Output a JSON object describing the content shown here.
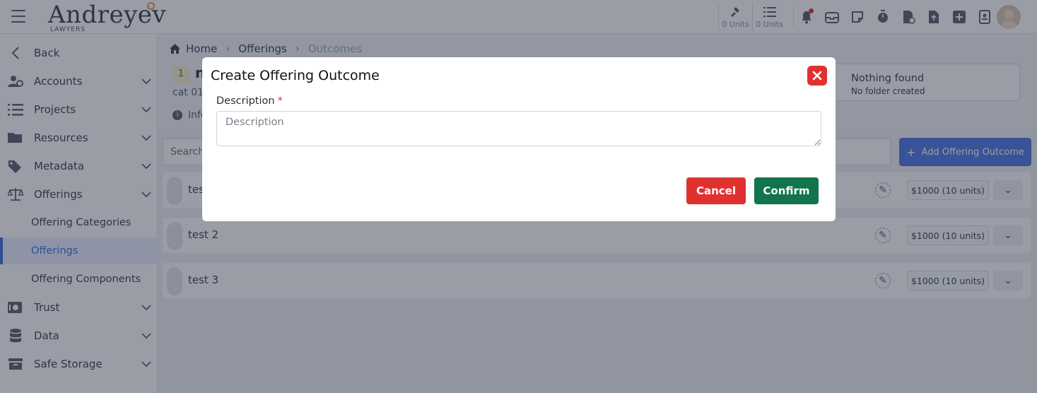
{
  "header": {
    "logo_main": "Andreyev",
    "logo_sub": "LAWYERS",
    "units": [
      {
        "label": "0 Units",
        "icon": "gavel-icon"
      },
      {
        "label": "0 Units",
        "icon": "list-icon"
      }
    ],
    "icons": [
      "bell-icon",
      "inbox-icon",
      "note-icon",
      "timer-icon",
      "billing-icon",
      "upload-icon",
      "add-icon",
      "contact-card-icon"
    ]
  },
  "sidebar": {
    "back": "Back",
    "items": [
      {
        "label": "Accounts",
        "icon": "accounts-icon"
      },
      {
        "label": "Projects",
        "icon": "projects-icon"
      },
      {
        "label": "Resources",
        "icon": "folder-icon"
      },
      {
        "label": "Metadata",
        "icon": "tags-icon"
      },
      {
        "label": "Offerings",
        "icon": "scale-icon"
      }
    ],
    "sub_items": [
      {
        "label": "Offering Categories"
      },
      {
        "label": "Offerings",
        "active": true
      },
      {
        "label": "Offering Components"
      }
    ],
    "more_items": [
      {
        "label": "Trust",
        "icon": "safe-icon"
      },
      {
        "label": "Data",
        "icon": "database-icon"
      },
      {
        "label": "Safe Storage",
        "icon": "archive-icon"
      }
    ]
  },
  "breadcrumb": {
    "home": "Home",
    "offerings": "Offerings",
    "current": "Outcomes"
  },
  "offering": {
    "id_badge": "1",
    "title_fragment": "n",
    "category_fragment": "cat 01",
    "info_fragment": "Info"
  },
  "folder_card": {
    "title": "Nothing found",
    "subtitle": "No folder created"
  },
  "toolbar": {
    "search_placeholder": "Search",
    "add_button": "Add Offering Outcome"
  },
  "rows": [
    {
      "name": "tes",
      "price": "$1000 (10 units)"
    },
    {
      "name": "test 2",
      "price": "$1000 (10 units)"
    },
    {
      "name": "test 3",
      "price": "$1000 (10 units)"
    }
  ],
  "modal": {
    "title": "Create Offering Outcome",
    "description_label": "Description",
    "required_mark": "*",
    "description_placeholder": "Description",
    "description_value": "",
    "cancel": "Cancel",
    "confirm": "Confirm"
  },
  "colors": {
    "primary": "#4f78e6",
    "danger": "#e03131",
    "success": "#11744a",
    "overlay": "rgba(30, 38, 58, 0.45)"
  }
}
